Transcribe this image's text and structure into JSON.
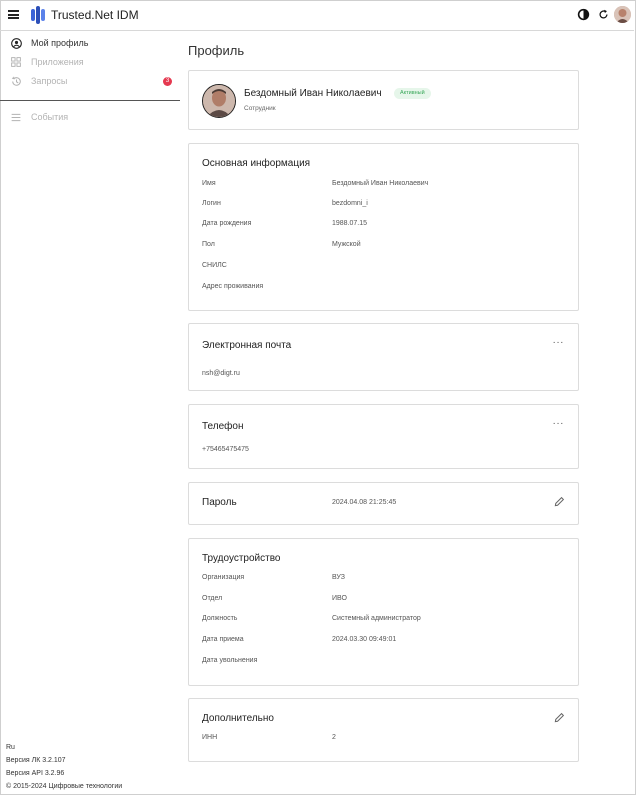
{
  "app": {
    "title": "Trusted.Net IDM"
  },
  "sidebar": {
    "items": [
      {
        "label": "Мой профиль",
        "icon": "user-circle-icon"
      },
      {
        "label": "Приложения",
        "icon": "apps-grid-icon"
      },
      {
        "label": "Запросы",
        "icon": "history-icon",
        "badge": "3"
      },
      {
        "label": "События",
        "icon": "list-icon"
      }
    ]
  },
  "footer": {
    "lang": "Ru",
    "version_lk": "Версия ЛК 3.2.107",
    "version_api": "Версия API 3.2.96",
    "copyright": "© 2015-2024 Цифровые технологии"
  },
  "page": {
    "title": "Профиль"
  },
  "user": {
    "name": "Бездомный Иван Николаевич",
    "status": "Активный",
    "role": "Сотрудник"
  },
  "basic": {
    "title": "Основная информация",
    "rows": [
      {
        "label": "Имя",
        "value": "Бездомный Иван Николаевич"
      },
      {
        "label": "Логин",
        "value": "bezdomni_i"
      },
      {
        "label": "Дата рождения",
        "value": "1988.07.15"
      },
      {
        "label": "Пол",
        "value": "Мужской"
      },
      {
        "label": "СНИЛС",
        "value": ""
      },
      {
        "label": "Адрес проживания",
        "value": ""
      }
    ]
  },
  "email": {
    "title": "Электронная почта",
    "value": "nsh@digt.ru",
    "more": "···"
  },
  "phone": {
    "title": "Телефон",
    "value": "+75465475475",
    "more": "···"
  },
  "password": {
    "title": "Пароль",
    "value": "2024.04.08 21:25:45"
  },
  "employment": {
    "title": "Трудоустройство",
    "rows": [
      {
        "label": "Организация",
        "value": "ВУЗ"
      },
      {
        "label": "Отдел",
        "value": "ИВО"
      },
      {
        "label": "Должность",
        "value": "Системный администратор"
      },
      {
        "label": "Дата приема",
        "value": "2024.03.30 09:49:01"
      },
      {
        "label": "Дата увольнения",
        "value": ""
      }
    ]
  },
  "additional": {
    "title": "Дополнительно",
    "rows": [
      {
        "label": "ИНН",
        "value": "2"
      }
    ]
  },
  "colors": {
    "accent": "#2f5fd6",
    "badge": "#e53950",
    "status_bg": "#e6f6ea",
    "status_text": "#3aa85a"
  }
}
